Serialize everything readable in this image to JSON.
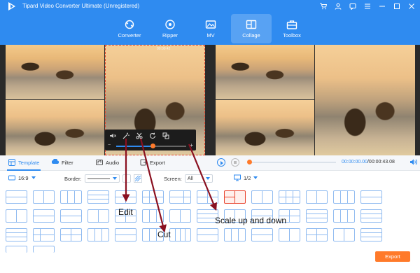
{
  "app": {
    "title": "Tipard Video Converter Ultimate (Unregistered)"
  },
  "nav_tabs": [
    {
      "label": "Converter",
      "icon": "converter-icon"
    },
    {
      "label": "Ripper",
      "icon": "ripper-icon"
    },
    {
      "label": "MV",
      "icon": "mv-icon"
    },
    {
      "label": "Collage",
      "icon": "collage-icon",
      "active": true
    },
    {
      "label": "Toolbox",
      "icon": "toolbox-icon"
    }
  ],
  "preview": {
    "time_overlay": "00:00:42"
  },
  "option_tabs": [
    {
      "label": "Template",
      "icon": "template-icon",
      "active": true
    },
    {
      "label": "Filter",
      "icon": "filter-icon"
    },
    {
      "label": "Audio",
      "icon": "audio-icon"
    },
    {
      "label": "Export",
      "icon": "export-icon"
    }
  ],
  "player": {
    "current_time": "00:00:00.00",
    "total_time": "/00:00:43.08"
  },
  "settings": {
    "ratio": "16:9",
    "border_label": "Border:",
    "screen_label": "Screen:",
    "screen_value": "All",
    "page_value": "1/2"
  },
  "annotations": {
    "edit": "Edit",
    "cut": "Cut",
    "scale": "Scale up and down"
  },
  "export_button": "Export",
  "colors": {
    "brand": "#2f8bf0",
    "accent": "#ff7a2a",
    "selection": "#e8442e"
  }
}
